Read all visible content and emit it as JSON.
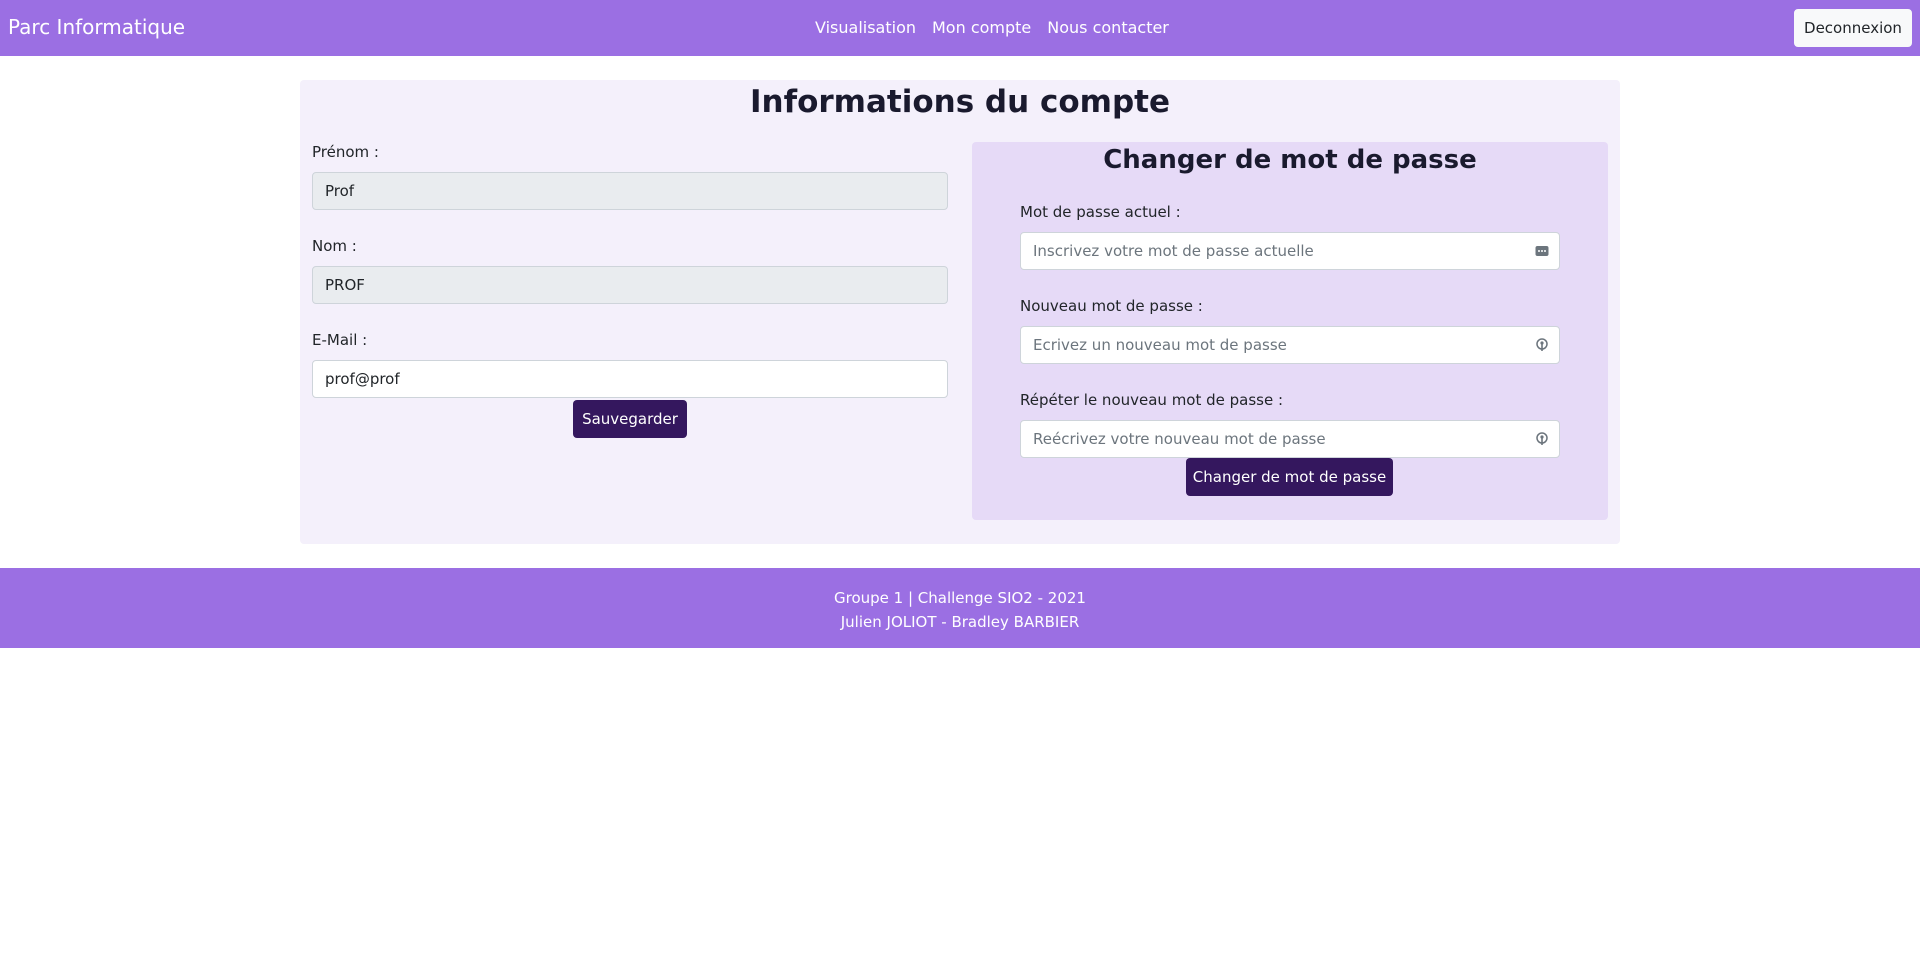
{
  "header": {
    "brand": "Parc Informatique",
    "nav": [
      "Visualisation",
      "Mon compte",
      "Nous contacter"
    ],
    "logout_label": "Deconnexion"
  },
  "account": {
    "title": "Informations du compte",
    "firstname_label": "Prénom :",
    "firstname_value": "Prof",
    "lastname_label": "Nom :",
    "lastname_value": "PROF",
    "email_label": "E-Mail :",
    "email_value": "prof@prof",
    "save_label": "Sauvegarder"
  },
  "password": {
    "title": "Changer de mot de passe",
    "current_label": "Mot de passe actuel :",
    "current_placeholder": "Inscrivez votre mot de passe actuelle",
    "new_label": "Nouveau mot de passe :",
    "new_placeholder": "Ecrivez un nouveau mot de passe",
    "repeat_label": "Répéter le nouveau mot de passe :",
    "repeat_placeholder": "Reécrivez votre nouveau mot de passe",
    "submit_label": "Changer de mot de passe"
  },
  "footer": {
    "line1": "Groupe 1 | Challenge SIO2 - 2021",
    "line2": "Julien JOLIOT - Bradley BARBIER"
  },
  "colors": {
    "navbar": "#9b6fe3",
    "card_bg": "#f4f0fb",
    "pwd_card_bg": "#e6daf7",
    "button": "#34175e"
  }
}
